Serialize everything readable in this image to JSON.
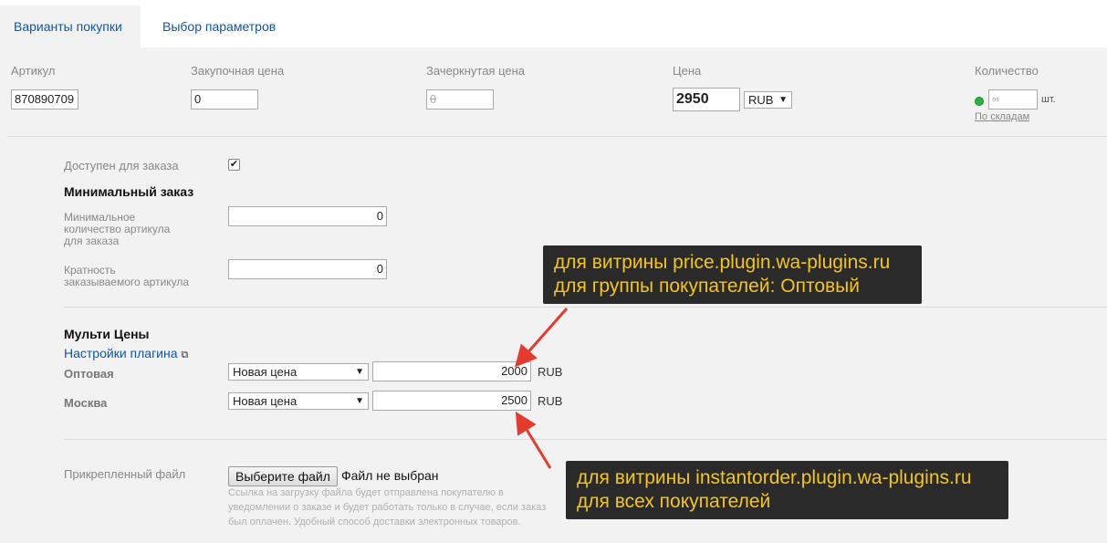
{
  "tabs": {
    "variants": "Варианты покупки",
    "params": "Выбор параметров"
  },
  "sku": {
    "article_label": "Артикул",
    "article_value": "870890709",
    "purchase_label": "Закупочная цена",
    "purchase_value": "0",
    "compare_label": "Зачеркнутая цена",
    "compare_value": "0",
    "price_label": "Цена",
    "price_value": "2950",
    "currency": "RUB",
    "qty_label": "Количество",
    "qty_placeholder": "∞",
    "qty_unit": "шт.",
    "by_stocks": "По складам",
    "stock_status_color": "#2db33d"
  },
  "order": {
    "available_label": "Доступен для заказа",
    "available_checked": "✔",
    "min_order_heading": "Минимальный заказ",
    "min_qty_label_1": "Минимальное",
    "min_qty_label_2": "количество артикула",
    "min_qty_label_3": "для заказа",
    "min_qty_value": "0",
    "multiple_label_1": "Кратность",
    "multiple_label_2": "заказываемого артикула",
    "multiple_value": "0"
  },
  "multiprice": {
    "heading": "Мульти Цены",
    "settings_link": "Настройки плагина",
    "rows": [
      {
        "name": "Оптовая",
        "type": "Новая цена",
        "value": "2000",
        "currency": "RUB"
      },
      {
        "name": "Москва",
        "type": "Новая цена",
        "value": "2500",
        "currency": "RUB"
      }
    ]
  },
  "file": {
    "label": "Прикрепленный файл",
    "button": "Выберите файл",
    "status": "Файл не выбран",
    "note_1": "Ссылка на загрузку файла будет отправлена покупателю в",
    "note_2": "уведомлении о заказе и будет работать только в случае, если заказ",
    "note_3": "был оплачен. Удобный способ доставки электронных товаров."
  },
  "callouts": {
    "top_line_1": "для витрины price.plugin.wa-plugins.ru",
    "top_line_2": "для группы покупателей: Оптовый",
    "bottom_line_1": "для витрины instantorder.plugin.wa-plugins.ru",
    "bottom_line_2": "для всех покупателей"
  },
  "colors": {
    "accent_link": "#0b58a8",
    "callout_bg": "#2a2a2a",
    "callout_text": "#f5c518",
    "arrow": "#e53a2e"
  }
}
